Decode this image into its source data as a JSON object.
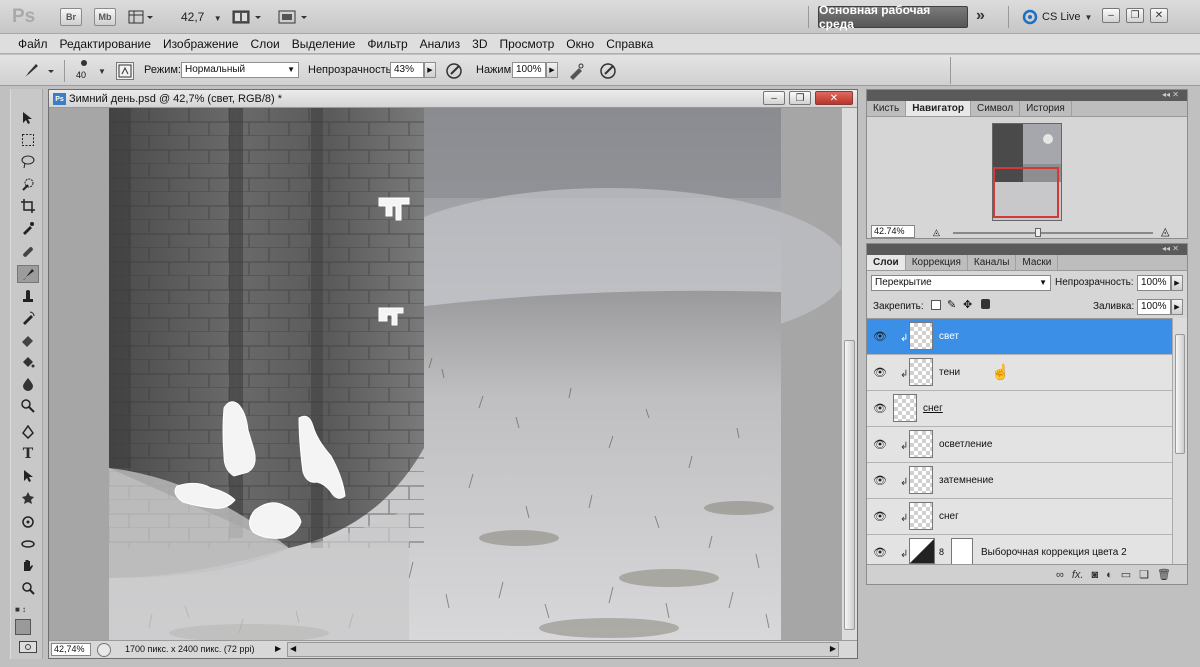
{
  "app": {
    "logo": "Ps",
    "bridge_btn": "Br",
    "minibridge_btn": "Mb",
    "zoom": "42,7",
    "workspace": "Основная рабочая среда",
    "cs_live": "CS Live"
  },
  "menu": [
    "Файл",
    "Редактирование",
    "Изображение",
    "Слои",
    "Выделение",
    "Фильтр",
    "Анализ",
    "3D",
    "Просмотр",
    "Окно",
    "Справка"
  ],
  "options": {
    "brush_size": "40",
    "mode_label": "Режим:",
    "mode_value": "Нормальный",
    "opacity_label": "Непрозрачность:",
    "opacity_value": "43%",
    "flow_label": "Нажим:",
    "flow_value": "100%"
  },
  "document": {
    "title": "Зимний день.psd @ 42,7% (свет, RGB/8) *",
    "status_zoom": "42,74%",
    "status_info": "1700 пикс. x 2400 пикс. (72 ppi)"
  },
  "navigator": {
    "tabs": [
      "Кисть",
      "Навигатор",
      "Символ",
      "История"
    ],
    "active_tab": 1,
    "zoom": "42.74%"
  },
  "layers_panel": {
    "tabs": [
      "Слои",
      "Коррекция",
      "Каналы",
      "Маски"
    ],
    "active_tab": 0,
    "blend_mode": "Перекрытие",
    "opacity_label": "Непрозрачность:",
    "opacity_value": "100%",
    "lock_label": "Закрепить:",
    "fill_label": "Заливка:",
    "fill_value": "100%",
    "layers": [
      {
        "name": "свет",
        "selected": true,
        "clipped": true
      },
      {
        "name": "тени",
        "selected": false,
        "clipped": true
      },
      {
        "name": "снег",
        "selected": false,
        "clipped": false
      },
      {
        "name": "осветление",
        "selected": false,
        "clipped": true
      },
      {
        "name": "затемнение",
        "selected": false,
        "clipped": true
      },
      {
        "name": "снег",
        "selected": false,
        "clipped": true
      },
      {
        "name": "Выборочная коррекция цвета 2",
        "selected": false,
        "clipped": true
      }
    ]
  },
  "colors": {
    "selection": "#3b8fe6",
    "nav_box": "#d23a3a"
  }
}
